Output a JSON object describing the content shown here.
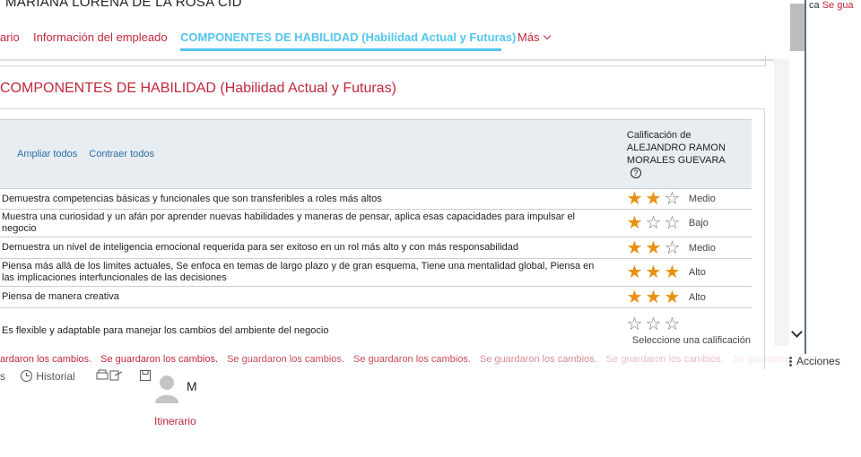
{
  "header": {
    "employee_name": "MARIANA LORENA DE LA ROSA CID"
  },
  "tabs": [
    {
      "label": "ario"
    },
    {
      "label": "Información del empleado"
    },
    {
      "label": "COMPONENTES DE HABILIDAD (Habilidad Actual y Futuras)"
    },
    {
      "label": "Más"
    }
  ],
  "section": {
    "title": "COMPONENTES DE HABILIDAD (Habilidad Actual y Futuras)",
    "expand_all": "Ampliar todos",
    "collapse_all": "Contraer todos",
    "rating_header_line1": "Calificación de",
    "rating_header_line2": "ALEJANDRO RAMON",
    "rating_header_line3": "MORALES GUEVARA",
    "help_glyph": "?"
  },
  "rows": [
    {
      "description": "Demuestra competencias básicas y funcionales que son transferibles a roles más altos",
      "rating": 2,
      "level": "Medio"
    },
    {
      "description": "Muestra una curiosidad y un afán por aprender nuevas habilidades y maneras de pensar, aplica esas capacidades para impulsar el negocio",
      "rating": 1,
      "level": "Bajo"
    },
    {
      "description": "Demuestra un nivel de inteligencia emocional requerida para ser exitoso en un rol más alto y con más responsabilidad",
      "rating": 2,
      "level": "Medio"
    },
    {
      "description": "Piensa más allá de los limites actuales, Se enfoca en temas de largo plazo y de gran esquema, Tiene una mentalidad global, Piensa en las implicaciones interfuncionales de las decisiones",
      "rating": 3,
      "level": "Alto"
    },
    {
      "description": "Piensa de manera creativa",
      "rating": 3,
      "level": "Alto"
    },
    {
      "description": "Es flexible y adaptable para manejar los cambios del ambiente del negocio",
      "rating": 0,
      "level": "Seleccione una calificación"
    }
  ],
  "notifications": {
    "saved_message": "Se guardaron los cambios.",
    "saved_prefix": "ardaron los cambios.",
    "top_right_prefix": "ca",
    "top_right_message": "Se gua"
  },
  "footer": {
    "left_fragment": "s",
    "history_label": "Historial",
    "avatar_initial": "M",
    "itinerary_label": "Itinerario",
    "actions_label": "Acciones"
  },
  "colors": {
    "brand_red": "#c0283c",
    "active_tab": "#53c5ef",
    "star_on": "#e8900f",
    "header_bg": "#e8edf2"
  }
}
